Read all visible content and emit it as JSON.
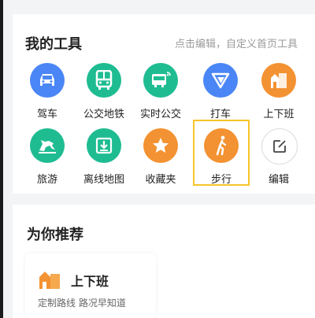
{
  "tools_section": {
    "title": "我的工具",
    "hint": "点击编辑，自定义首页工具",
    "items": [
      {
        "label": "驾车",
        "icon": "car-icon",
        "color": "#4a86f5"
      },
      {
        "label": "公交地铁",
        "icon": "bus-icon",
        "color": "#1fbc92"
      },
      {
        "label": "实时公交",
        "icon": "realtime-bus-icon",
        "color": "#1fbc92"
      },
      {
        "label": "打车",
        "icon": "taxi-icon",
        "color": "#4a86f5"
      },
      {
        "label": "上下班",
        "icon": "commute-icon",
        "color": "#f39232"
      },
      {
        "label": "旅游",
        "icon": "travel-icon",
        "color": "#1fbc92"
      },
      {
        "label": "离线地图",
        "icon": "offline-map-icon",
        "color": "#1fbc92"
      },
      {
        "label": "收藏夹",
        "icon": "favorites-icon",
        "color": "#f39232"
      },
      {
        "label": "步行",
        "icon": "walk-icon",
        "color": "#f39232"
      },
      {
        "label": "编辑",
        "icon": "edit-icon",
        "color": "#ffffff"
      }
    ]
  },
  "recommend_section": {
    "title": "为你推荐",
    "card": {
      "name": "上下班",
      "desc": "定制路线 路况早知道"
    }
  }
}
